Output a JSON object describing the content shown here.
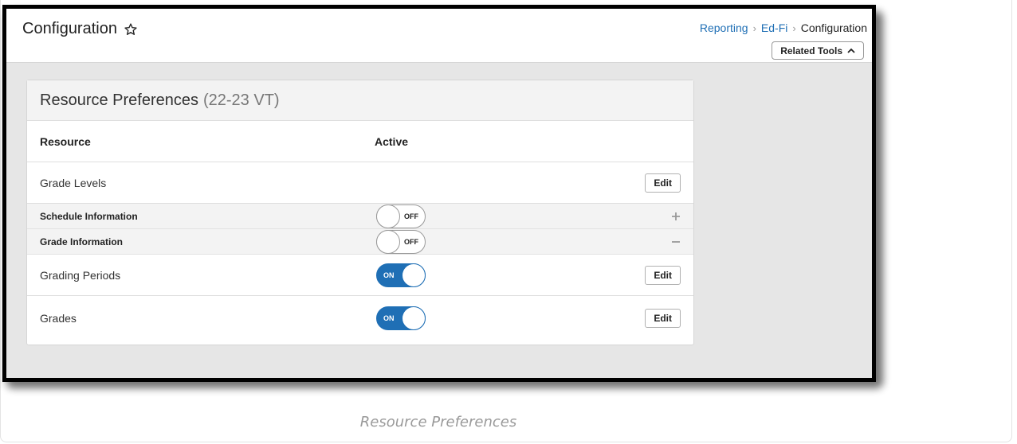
{
  "header": {
    "title": "Configuration",
    "breadcrumb": [
      "Reporting",
      "Ed-Fi",
      "Configuration"
    ],
    "related_tools_label": "Related Tools"
  },
  "card": {
    "title": "Resource Preferences",
    "term": "(22-23 VT)",
    "columns": {
      "resource": "Resource",
      "active": "Active"
    },
    "rows": [
      {
        "label": "Grade Levels",
        "edit": "Edit"
      },
      {
        "label": "Schedule Information",
        "toggle": "OFF"
      },
      {
        "label": "Grade Information",
        "toggle": "OFF"
      },
      {
        "label": "Grading Periods",
        "toggle": "ON",
        "edit": "Edit"
      },
      {
        "label": "Grades",
        "toggle": "ON",
        "edit": "Edit"
      }
    ]
  },
  "caption": "Resource Preferences",
  "colors": {
    "accent": "#1f6fb5",
    "panel": "#e6e6e6",
    "subrow": "#f3f3f3"
  },
  "icons": {
    "favorite": "star-outline-icon",
    "related_tools": "chevron-up-icon",
    "expand": "plus-icon",
    "collapse": "minus-icon"
  }
}
